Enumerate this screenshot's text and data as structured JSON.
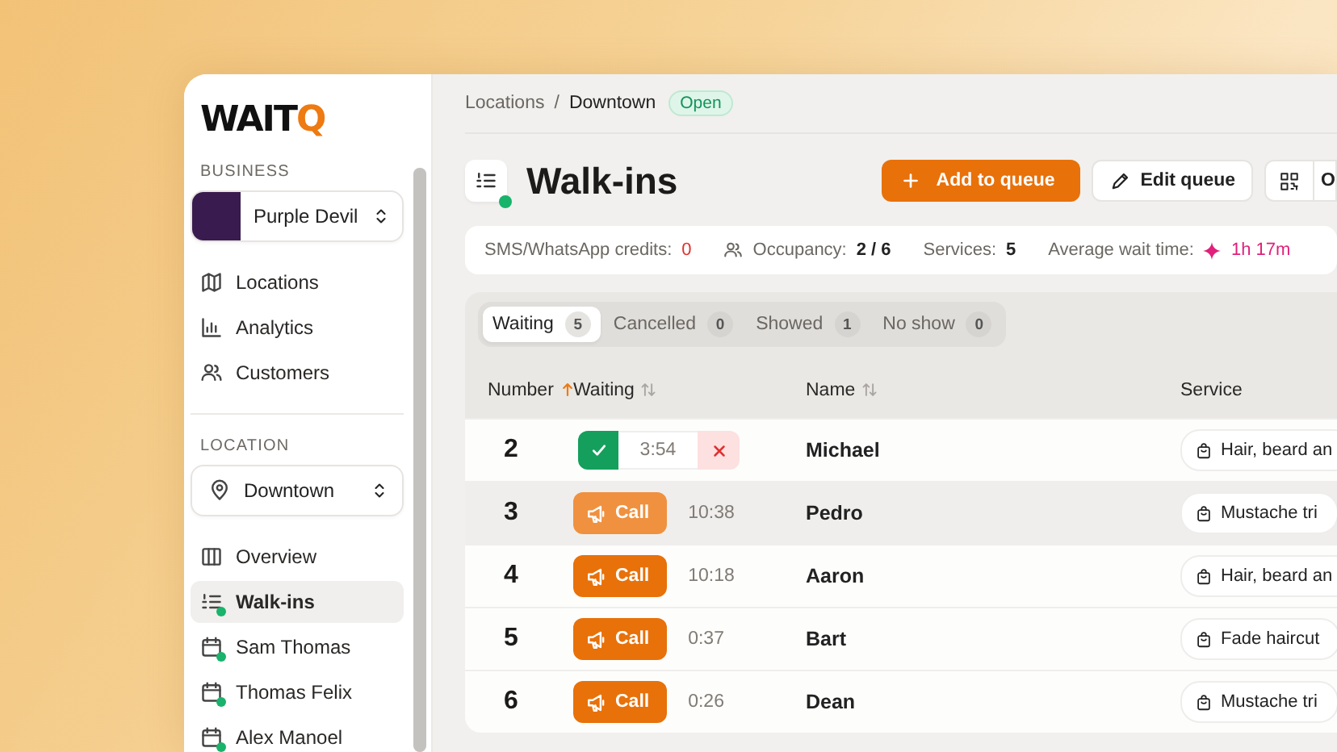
{
  "sidebar": {
    "logo": {
      "text": "WAIT",
      "accent": "Q"
    },
    "business": {
      "label": "BUSINESS",
      "selector": "Purple Devil",
      "nav": [
        {
          "label": "Locations",
          "selected": false,
          "online": false
        },
        {
          "label": "Analytics",
          "selected": false,
          "online": false
        },
        {
          "label": "Customers",
          "selected": false,
          "online": false
        }
      ]
    },
    "location": {
      "label": "LOCATION",
      "selector": "Downtown",
      "nav": [
        {
          "label": "Overview",
          "selected": false,
          "online": false
        },
        {
          "label": "Walk-ins",
          "selected": true,
          "online": true
        },
        {
          "label": "Sam Thomas",
          "selected": false,
          "online": true
        },
        {
          "label": "Thomas Felix",
          "selected": false,
          "online": true
        },
        {
          "label": "Alex Manoel",
          "selected": false,
          "online": true
        }
      ]
    }
  },
  "breadcrumb": {
    "items": [
      "Locations",
      "Downtown"
    ],
    "separator": "/",
    "badge": "Open"
  },
  "header": {
    "title": "Walk-ins",
    "online": true,
    "buttons": [
      {
        "kind": "primary",
        "label": "Add to queue"
      },
      {
        "kind": "edit",
        "label": "Edit queue"
      },
      {
        "kind": "qr",
        "label": "O"
      }
    ]
  },
  "stats": [
    {
      "kind": "alert",
      "label": "SMS/WhatsApp credits:",
      "value": "0"
    },
    {
      "kind": "people",
      "label": "Occupancy:",
      "value": "2 / 6"
    },
    {
      "kind": "plain",
      "label": "Services:",
      "value": "5"
    },
    {
      "kind": "highlight",
      "label": "Average wait time:",
      "value": "1h 17m"
    }
  ],
  "tabs": [
    {
      "label": "Waiting",
      "count": "5",
      "selected": true
    },
    {
      "label": "Cancelled",
      "count": "0",
      "selected": false
    },
    {
      "label": "Showed",
      "count": "1",
      "selected": false
    },
    {
      "label": "No show",
      "count": "0",
      "selected": false
    }
  ],
  "table": {
    "columns": [
      {
        "label": "Number",
        "sorted_ascending": true,
        "sortable": false
      },
      {
        "label": "Waiting",
        "sorted_ascending": false,
        "sortable": true
      },
      {
        "label": "Name",
        "sorted_ascending": false,
        "sortable": true
      },
      {
        "label": "Service",
        "sorted_ascending": false,
        "sortable": false
      }
    ],
    "rows": [
      {
        "number": "2",
        "kind": "serving",
        "timer": "3:54",
        "name": "Michael",
        "service": "Hair, beard an",
        "hovered": false
      },
      {
        "number": "3",
        "kind": "waiting",
        "call": "Call",
        "time": "10:38",
        "name": "Pedro",
        "service": "Mustache tri",
        "hovered": true
      },
      {
        "number": "4",
        "kind": "waiting",
        "call": "Call",
        "time": "10:18",
        "name": "Aaron",
        "service": "Hair, beard an",
        "hovered": false
      },
      {
        "number": "5",
        "kind": "waiting",
        "call": "Call",
        "time": "0:37",
        "name": "Bart",
        "service": "Fade haircut",
        "hovered": false
      },
      {
        "number": "6",
        "kind": "waiting",
        "call": "Call",
        "time": "0:26",
        "name": "Dean",
        "service": "Mustache tri",
        "hovered": false
      }
    ]
  }
}
